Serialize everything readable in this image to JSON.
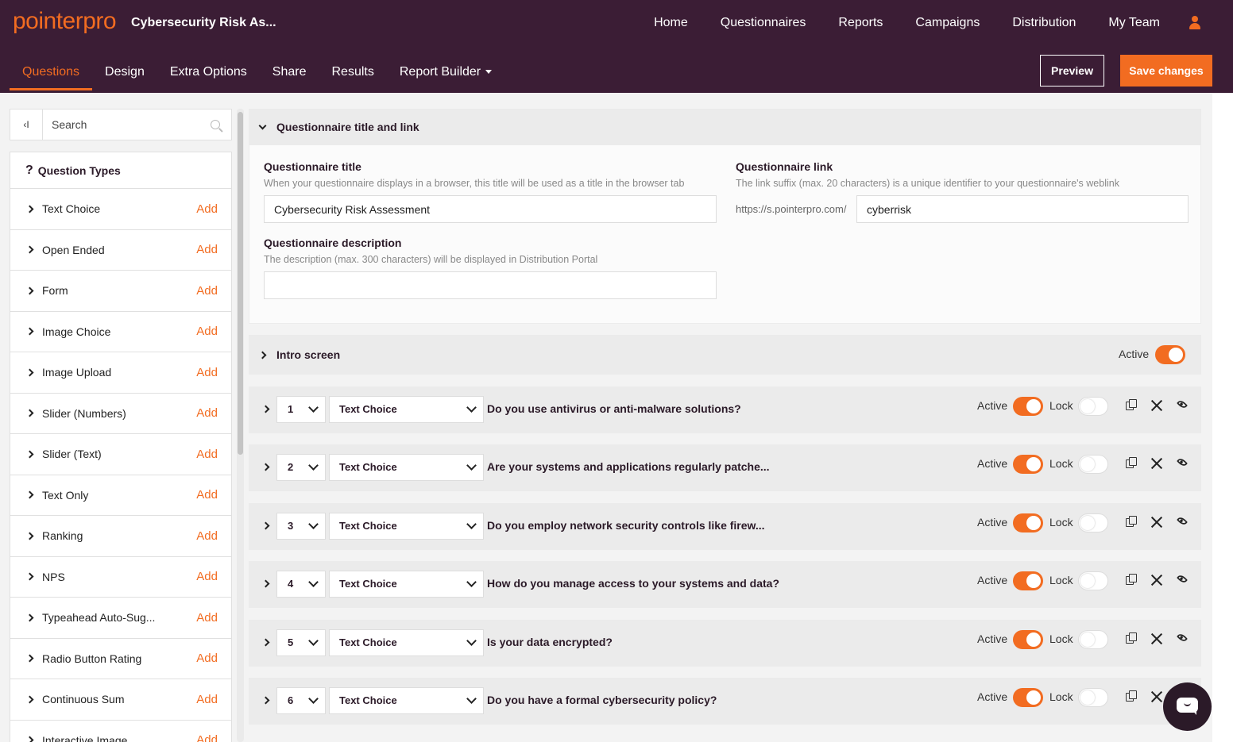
{
  "app": {
    "logo": "pointerpro",
    "doc_title": "Cybersecurity Risk As..."
  },
  "colors": {
    "brand_dark": "#3b1d35",
    "accent": "#f26c21"
  },
  "main_nav": [
    "Home",
    "Questionnaires",
    "Reports",
    "Campaigns",
    "Distribution",
    "My Team"
  ],
  "sub_nav": {
    "tabs": [
      "Questions",
      "Design",
      "Extra Options",
      "Share",
      "Results",
      "Report Builder"
    ],
    "active": "Questions"
  },
  "actions": {
    "preview": "Preview",
    "save": "Save changes"
  },
  "sidebar": {
    "collapse": "‹I",
    "search_placeholder": "Search",
    "header_icon": "?",
    "header": "Question Types",
    "add_label": "Add",
    "items": [
      "Text Choice",
      "Open Ended",
      "Form",
      "Image Choice",
      "Image Upload",
      "Slider (Numbers)",
      "Slider (Text)",
      "Text Only",
      "Ranking",
      "NPS",
      "Typeahead Auto-Sug...",
      "Radio Button Rating",
      "Continuous Sum",
      "Interactive Image"
    ]
  },
  "title_panel": {
    "heading": "Questionnaire title and link",
    "title_label": "Questionnaire title",
    "title_help": "When your questionnaire displays in a browser, this title will be used as a title in the browser tab",
    "title_value": "Cybersecurity Risk Assessment",
    "desc_label": "Questionnaire description",
    "desc_help": "The description (max. 300 characters) will be displayed in Distribution Portal",
    "desc_value": "",
    "link_label": "Questionnaire link",
    "link_help": "The link suffix (max. 20 characters) is a unique identifier to your questionnaire's weblink",
    "link_prefix": "https://s.pointerpro.com/",
    "link_value": "cyberrisk"
  },
  "intro": {
    "label": "Intro screen",
    "active_label": "Active",
    "active": true
  },
  "question_labels": {
    "active": "Active",
    "lock": "Lock"
  },
  "questions": [
    {
      "num": "1",
      "type": "Text Choice",
      "text": "Do you use antivirus or anti-malware solutions?",
      "active": true,
      "lock": false
    },
    {
      "num": "2",
      "type": "Text Choice",
      "text": "Are your systems and applications regularly patche...",
      "active": true,
      "lock": false
    },
    {
      "num": "3",
      "type": "Text Choice",
      "text": "Do you employ network security controls like firew...",
      "active": true,
      "lock": false
    },
    {
      "num": "4",
      "type": "Text Choice",
      "text": "How do you manage access to your systems and data?",
      "active": true,
      "lock": false
    },
    {
      "num": "5",
      "type": "Text Choice",
      "text": "Is your data encrypted?",
      "active": true,
      "lock": false
    },
    {
      "num": "6",
      "type": "Text Choice",
      "text": "Do you have a formal cybersecurity policy?",
      "active": true,
      "lock": false
    }
  ]
}
